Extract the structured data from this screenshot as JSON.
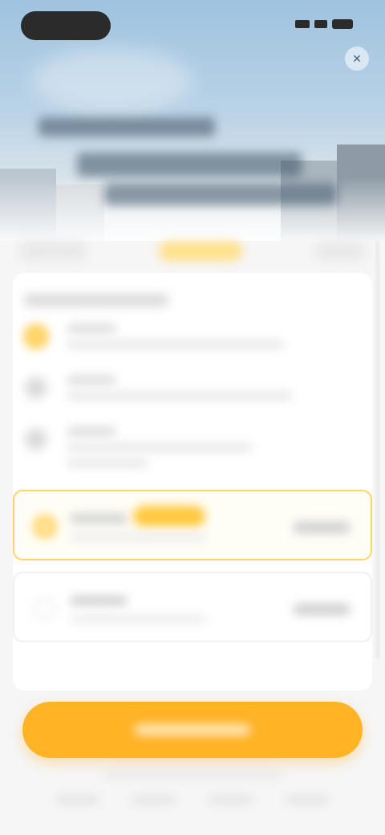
{
  "header": {
    "close_icon": "close-icon"
  },
  "colors": {
    "accent": "#ffb325",
    "selected_border": "#ffd466",
    "badge": "#ffc83d",
    "background": "#f6f6f6"
  },
  "tabs": [
    {
      "selected": false
    },
    {
      "selected": true
    },
    {
      "selected": false
    }
  ],
  "features": [
    {
      "icon": "star-icon",
      "active": true
    },
    {
      "icon": "circle-icon",
      "active": false
    },
    {
      "icon": "circle-icon",
      "active": false
    }
  ],
  "plans": [
    {
      "selected": true,
      "has_badge": true
    },
    {
      "selected": false,
      "has_badge": false
    }
  ]
}
